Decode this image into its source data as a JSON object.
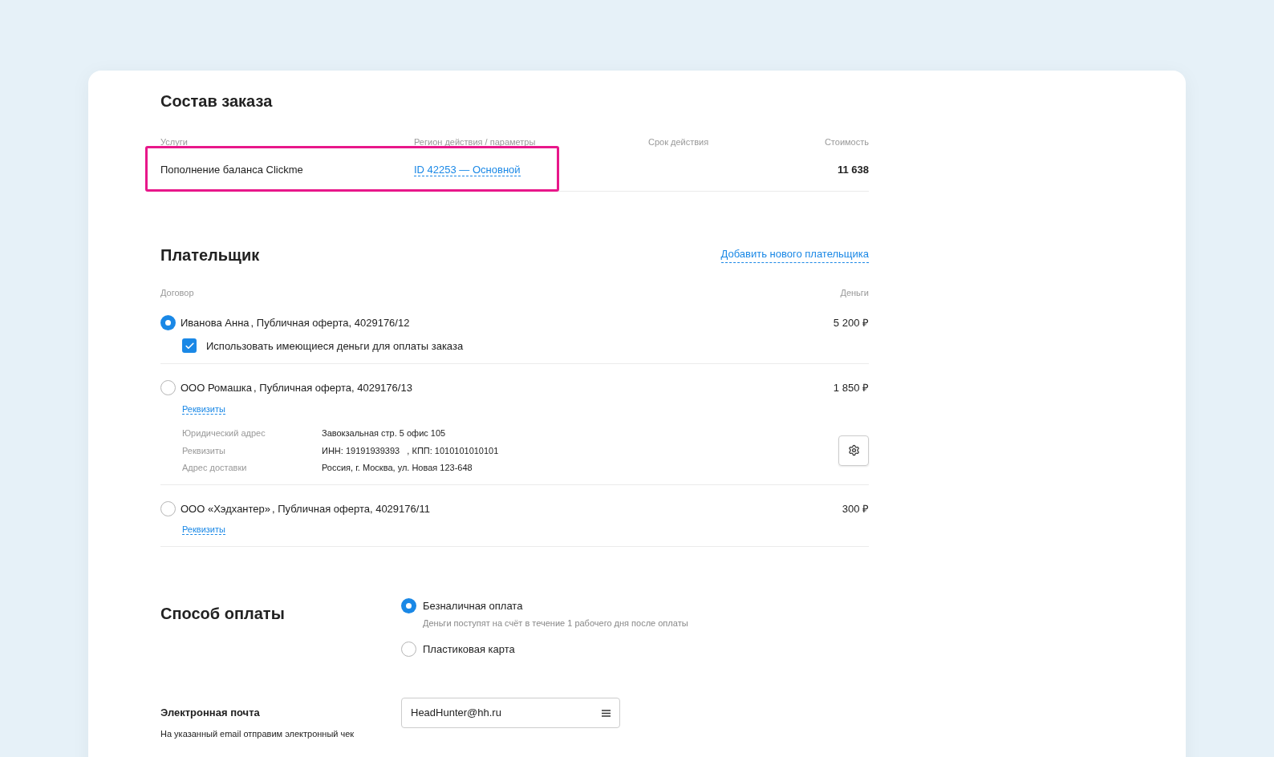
{
  "order": {
    "title": "Состав заказа",
    "columns": [
      "Услуги",
      "Регион действия / параметры",
      "Срок действия",
      "Стоимость"
    ],
    "rows": [
      {
        "service": "Пополнение баланса Clickme",
        "region": "ID 42253 — Основной",
        "price": "11 638",
        "highlighted": true
      }
    ]
  },
  "payer": {
    "title": "Плательщик",
    "add_link": "Добавить нового плательщика",
    "columns": [
      "Договор",
      "Деньги"
    ],
    "items": [
      {
        "name": "Иванова Анна",
        "contract": ", Публичная оферта, 4029176/12",
        "amount": "5 200 ₽",
        "selected": true,
        "checkbox": {
          "label": "Использовать имеющиеся деньги для оплаты заказа",
          "checked": true
        }
      },
      {
        "name": "ООО Ромашка",
        "contract": ", Публичная оферта, 4029176/13",
        "amount": "1 850 ₽",
        "selected": false,
        "link": "Реквизиты",
        "details": [
          {
            "label": "Юридический адрес",
            "value": "Завокзальная стр. 5 офис 105"
          },
          {
            "label": "Реквизиты",
            "value": "ИНН: 19191939393   , КПП: 1010101010101"
          },
          {
            "label": "Адрес доставки",
            "value": "Россия, г. Москва, ул. Новая 123-648"
          }
        ]
      },
      {
        "name": "ООО «Хэдхантер»",
        "contract": ", Публичная оферта, 4029176/11",
        "amount": "300 ₽",
        "selected": false,
        "link": "Реквизиты"
      }
    ]
  },
  "payment": {
    "title": "Способ оплаты",
    "options": [
      {
        "label": "Безналичная оплата",
        "hint": "Деньги поступят на счёт в течение 1 рабочего дня после оплаты",
        "selected": true
      },
      {
        "label": "Пластиковая карта",
        "selected": false
      }
    ]
  },
  "email": {
    "title": "Электронная почта",
    "hint": "На указанный email отправим электронный чек",
    "value": "HeadHunter@hh.ru"
  }
}
